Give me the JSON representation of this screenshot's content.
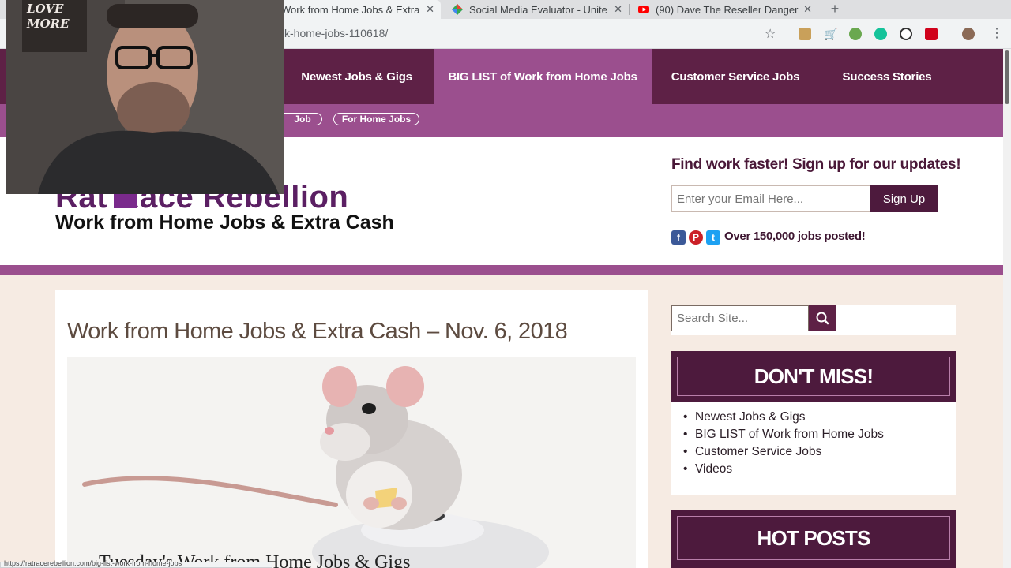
{
  "browser": {
    "tabs": [
      {
        "title": "Work from Home Jobs & Extra",
        "active": true
      },
      {
        "title": "Social Media Evaluator - United",
        "active": false
      },
      {
        "title": "(90) Dave The Reseller Danger",
        "active": false
      }
    ],
    "url": "k-home-jobs-110618/",
    "new_tab": "+",
    "status_url": "https://ratracerebellion.com/big-list-work-from-home-jobs"
  },
  "nav": {
    "items": [
      "Newest Jobs & Gigs",
      "BIG LIST of Work from Home Jobs",
      "Customer Service Jobs",
      "Success Stories"
    ],
    "active_index": 1
  },
  "subnav": {
    "pills": [
      "Job",
      "For Home Jobs"
    ]
  },
  "header": {
    "logo_line1": "Rat Race Rebellion",
    "logo_line2": "Work from Home Jobs & Extra Cash",
    "signup_title": "Find work faster! Sign up for our updates!",
    "email_placeholder": "Enter your Email Here...",
    "signup_button": "Sign Up",
    "jobs_posted": "Over 150,000 jobs posted!",
    "social_icons": [
      "facebook-icon",
      "pinterest-icon",
      "twitter-icon"
    ]
  },
  "post": {
    "title": "Work from Home Jobs & Extra Cash – Nov. 6, 2018",
    "image_caption": "Tuesday's Work from Home Jobs & Gigs"
  },
  "sidebar": {
    "search_placeholder": "Search Site...",
    "dont_miss": {
      "heading": "DON'T MISS!",
      "items": [
        "Newest Jobs & Gigs",
        "BIG LIST of Work from Home Jobs",
        "Customer Service Jobs",
        "Videos"
      ]
    },
    "hot_posts": {
      "heading": "HOT POSTS"
    }
  },
  "webcam": {
    "sign_text": "LOVE MORE"
  },
  "colors": {
    "nav_dark": "#5e2146",
    "nav_active": "#9b4f8e",
    "widget": "#4d1a3d",
    "page_bg": "#f6ebe3"
  }
}
